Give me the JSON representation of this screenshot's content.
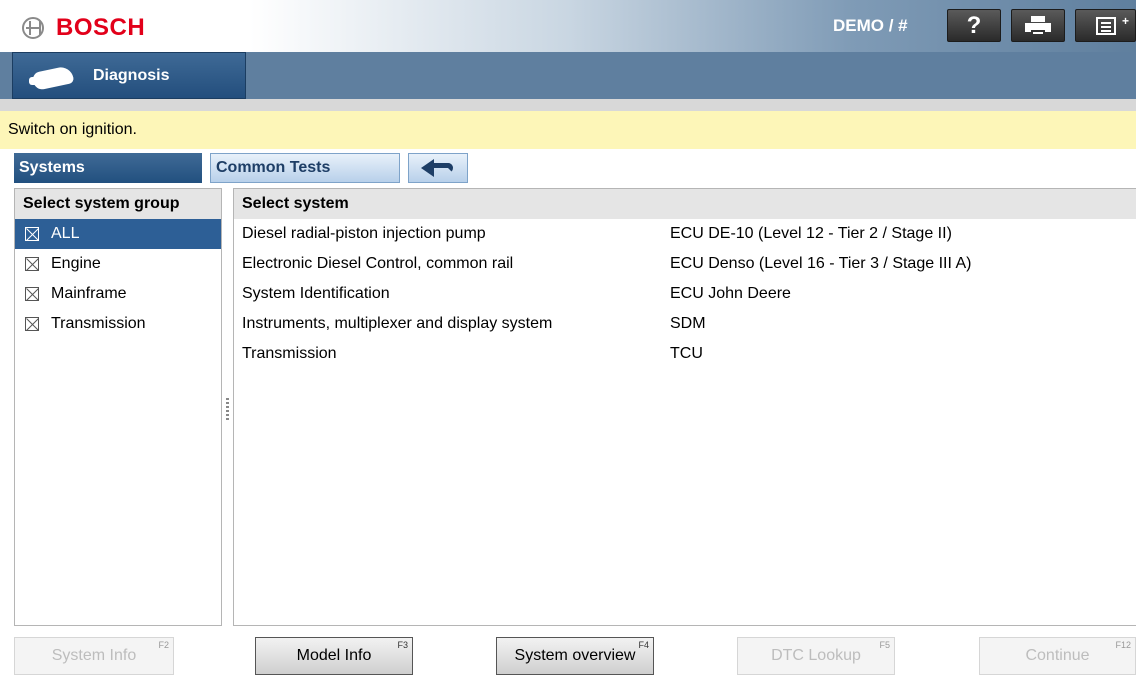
{
  "header": {
    "brand": "BOSCH",
    "user": "DEMO / #",
    "help_label": "?"
  },
  "nav": {
    "active_module": "Diagnosis"
  },
  "notice": "Switch on ignition.",
  "tabs": {
    "systems": "Systems",
    "common_tests": "Common Tests"
  },
  "group_panel": {
    "title": "Select system group",
    "items": [
      {
        "label": "ALL",
        "selected": true
      },
      {
        "label": "Engine",
        "selected": false
      },
      {
        "label": "Mainframe",
        "selected": false
      },
      {
        "label": "Transmission",
        "selected": false
      }
    ]
  },
  "system_panel": {
    "title": "Select system",
    "rows": [
      {
        "name": "Diesel radial-piston injection pump",
        "ecu": "ECU DE-10 (Level 12 - Tier 2 / Stage II)"
      },
      {
        "name": "Electronic Diesel Control, common rail",
        "ecu": "ECU Denso (Level 16 - Tier 3 / Stage III A)"
      },
      {
        "name": "System Identification",
        "ecu": "ECU John Deere"
      },
      {
        "name": "Instruments, multiplexer and display system",
        "ecu": "SDM"
      },
      {
        "name": "Transmission",
        "ecu": "TCU"
      }
    ]
  },
  "bottom_buttons": [
    {
      "label": "System Info",
      "fkey": "F2",
      "enabled": false
    },
    {
      "label": "Model Info",
      "fkey": "F3",
      "enabled": true
    },
    {
      "label": "System overview",
      "fkey": "F4",
      "enabled": true
    },
    {
      "label": "DTC Lookup",
      "fkey": "F5",
      "enabled": false
    },
    {
      "label": "Continue",
      "fkey": "F12",
      "enabled": false
    }
  ],
  "colors": {
    "brand_red": "#e2001a",
    "selection_blue": "#2d5f96",
    "notice_yellow": "#fdf6b8"
  }
}
